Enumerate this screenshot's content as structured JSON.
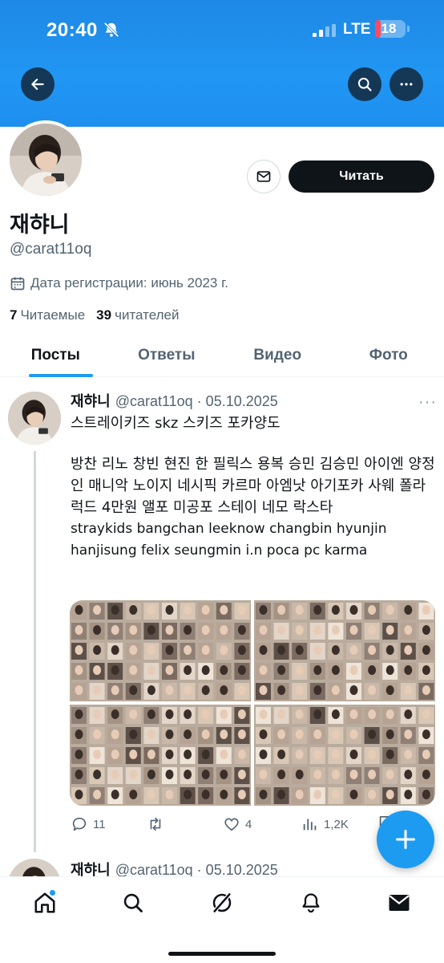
{
  "status_bar": {
    "time": "20:40",
    "network": "LTE",
    "battery": "18",
    "battery_level": 0.18,
    "battery_color": "#ff4a5a"
  },
  "header": {
    "back_icon": "arrow-left-icon",
    "search_icon": "search-icon",
    "more_icon": "more-icon",
    "banner_color": "#1e88e5"
  },
  "profile": {
    "display_name": "재햐니",
    "handle": "@carat11oq",
    "joined": "Дата регистрации: июнь 2023 г.",
    "following_count": "7",
    "following_label": "Читаемые",
    "followers_count": "39",
    "followers_label": "читателей",
    "follow_button": "Читать",
    "message_icon": "envelope-icon"
  },
  "tabs": [
    {
      "label": "Посты",
      "active": true
    },
    {
      "label": "Ответы",
      "active": false
    },
    {
      "label": "Видео",
      "active": false
    },
    {
      "label": "Фото",
      "active": false
    }
  ],
  "tweet": {
    "name": "재햐니",
    "meta": "@carat11oq · 05.10.2025",
    "line1": "스트레이키즈 skz 스키즈 포카양도",
    "line2": "방찬 리노 창빈 현진 한 필릭스 용복 승민 김승민 아이엔 양정인 매니악 노이지 네시픽 카르마 아엠낫 아기포카 사웨 폴라 럭드 4만원 앨포 미공포 스테이 네모 락스타",
    "line3": "straykids bangchan leeknow changbin hyunjin hanjisung felix seungmin i.n poca pc karma",
    "replies": "11",
    "retweets": "",
    "likes": "4",
    "views": "1,2K"
  },
  "tweet2": {
    "name": "재햐니",
    "meta": "@carat11oq · 05.10.2025"
  },
  "bottom_nav": [
    {
      "icon": "home-icon"
    },
    {
      "icon": "search-icon"
    },
    {
      "icon": "grok-icon"
    },
    {
      "icon": "bell-icon"
    },
    {
      "icon": "mail-icon"
    }
  ],
  "accent_color": "#1d9bf0"
}
